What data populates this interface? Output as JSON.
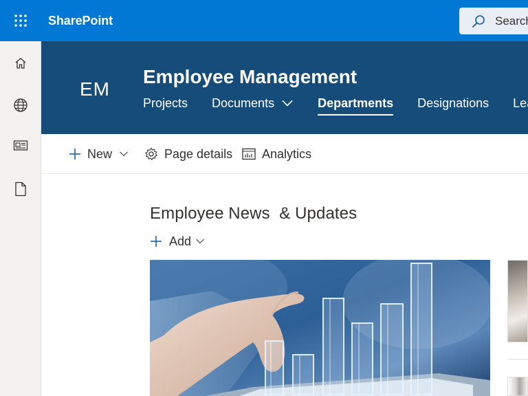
{
  "suitebar": {
    "app_name": "SharePoint",
    "search_label": "Search",
    "color": "#0078d4"
  },
  "leftrail": {
    "items": [
      {
        "icon": "home-icon"
      },
      {
        "icon": "globe-icon"
      },
      {
        "icon": "news-icon"
      },
      {
        "icon": "document-icon"
      }
    ]
  },
  "site": {
    "logo_text": "EM",
    "title": "Employee Management",
    "header_color": "#154c79",
    "nav": [
      {
        "label": "Projects"
      },
      {
        "label": "Documents",
        "has_dropdown": true
      },
      {
        "label": "Departments",
        "active": true
      },
      {
        "label": "Designations"
      },
      {
        "label": "Leave"
      }
    ]
  },
  "commandbar": {
    "new_label": "New",
    "page_details_label": "Page details",
    "analytics_label": "Analytics"
  },
  "news": {
    "title": "Employee News  & Updates",
    "add_label": "Add"
  }
}
